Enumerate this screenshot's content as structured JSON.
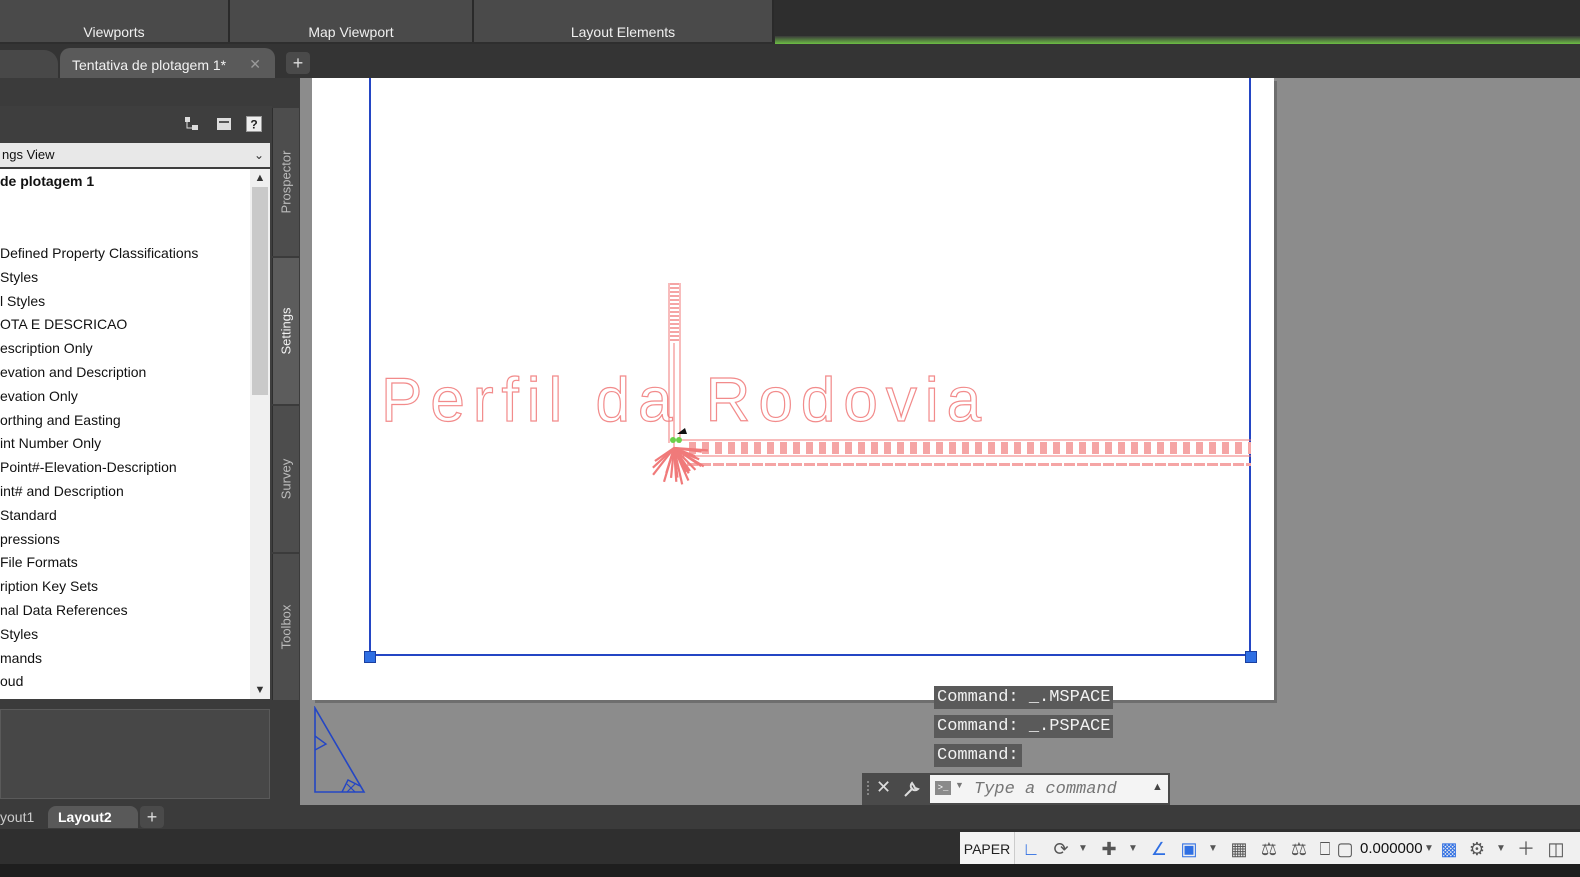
{
  "ribbon": {
    "panels": [
      "Viewports",
      "Map Viewport",
      "Layout Elements"
    ]
  },
  "document_tab": {
    "title": "Tentativa de plotagem 1*",
    "close_glyph": "✕",
    "new_tab_glyph": "+"
  },
  "palette": {
    "view_select": "ngs View",
    "tree_root": "de plotagem 1",
    "tree_items": [
      " Defined Property Classifications",
      " Styles",
      "l Styles",
      "OTA E DESCRICAO",
      "escription Only",
      "evation and Description",
      "evation Only",
      "orthing and Easting",
      "int Number Only",
      " Point#-Elevation-Description",
      "int# and Description",
      " Standard",
      "pressions",
      " File Formats",
      "ription Key Sets",
      "nal Data References",
      " Styles",
      "mands",
      "oud"
    ],
    "vertical_tabs": [
      "Prospector",
      "Settings",
      "Survey",
      "Toolbox"
    ],
    "active_vertical_tab": "Settings"
  },
  "drawing": {
    "title_text": "Perfil  da  Rodovia",
    "title_color": "#f28b8b",
    "frame_color": "#2446c4"
  },
  "command": {
    "history": [
      "Command:  _.MSPACE",
      "Command:  _.PSPACE",
      "Command:"
    ],
    "placeholder": "Type a command"
  },
  "layout_tabs": {
    "tabs": [
      "yout1",
      "Layout2"
    ],
    "active": "Layout2",
    "add_glyph": "+"
  },
  "status": {
    "space_label": "PAPER",
    "scale_value": "0.000000"
  }
}
